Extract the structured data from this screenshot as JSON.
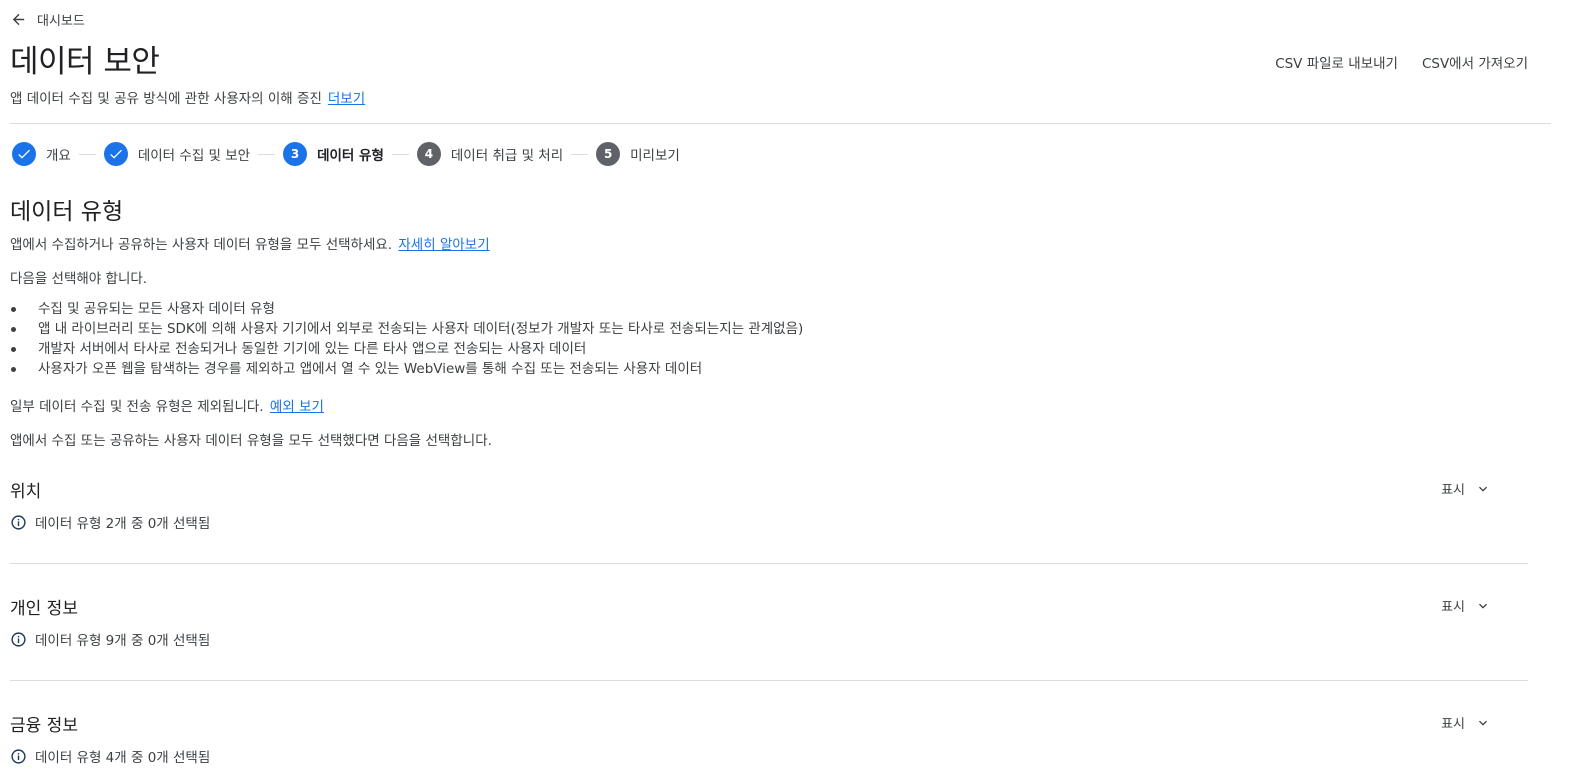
{
  "nav": {
    "back_label": "대시보드"
  },
  "header": {
    "title": "데이터 보안",
    "subtitle": "앱 데이터 수집 및 공유 방식에 관한 사용자의 이해 증진",
    "subtitle_link": "더보기",
    "actions": {
      "export_csv": "CSV 파일로 내보내기",
      "import_csv": "CSV에서 가져오기"
    }
  },
  "stepper": {
    "steps": [
      {
        "number": "1",
        "label": "개요",
        "status": "done"
      },
      {
        "number": "2",
        "label": "데이터 수집 및 보안",
        "status": "done"
      },
      {
        "number": "3",
        "label": "데이터 유형",
        "status": "current"
      },
      {
        "number": "4",
        "label": "데이터 취급 및 처리",
        "status": "todo"
      },
      {
        "number": "5",
        "label": "미리보기",
        "status": "todo"
      }
    ]
  },
  "content": {
    "title": "데이터 유형",
    "intro": "앱에서 수집하거나 공유하는 사용자 데이터 유형을 모두 선택하세요.",
    "intro_link": "자세히 알아보기",
    "must_select": "다음을 선택해야 합니다.",
    "bullets": [
      "수집 및 공유되는 모든 사용자 데이터 유형",
      "앱 내 라이브러리 또는 SDK에 의해 사용자 기기에서 외부로 전송되는 사용자 데이터(정보가 개발자 또는 타사로 전송되는지는 관계없음)",
      "개발자 서버에서 타사로 전송되거나 동일한 기기에 있는 다른 타사 앱으로 전송되는 사용자 데이터",
      "사용자가 오픈 웹을 탐색하는 경우를 제외하고 앱에서 열 수 있는 WebView를 통해 수집 또는 전송되는 사용자 데이터"
    ],
    "exclusion": "일부 데이터 수집 및 전송 유형은 제외됩니다.",
    "exclusion_link": "예외 보기",
    "after_select": "앱에서 수집 또는 공유하는 사용자 데이터 유형을 모두 선택했다면 다음을 선택합니다."
  },
  "categories": [
    {
      "title": "위치",
      "status": "데이터 유형 2개 중 0개 선택됨",
      "toggle": "표시"
    },
    {
      "title": "개인 정보",
      "status": "데이터 유형 9개 중 0개 선택됨",
      "toggle": "표시"
    },
    {
      "title": "금융 정보",
      "status": "데이터 유형 4개 중 0개 선택됨",
      "toggle": "표시"
    }
  ],
  "colors": {
    "accent": "#1a73e8",
    "inactive_step": "#5f6368",
    "divider": "#dadce0"
  }
}
